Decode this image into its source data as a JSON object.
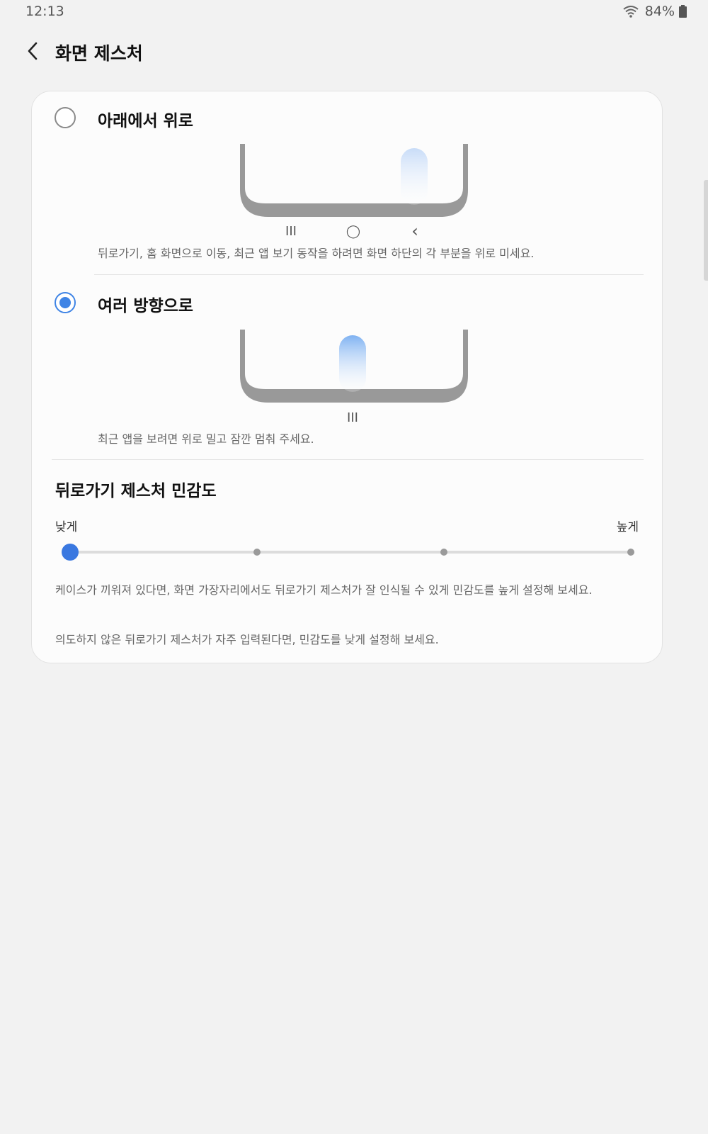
{
  "status": {
    "time": "12:13",
    "battery": "84%"
  },
  "header": {
    "title": "화면 제스처"
  },
  "options": [
    {
      "title": "아래에서 위로",
      "selected": false,
      "description": "뒤로가기, 홈 화면으로 이동, 최근 앱 보기 동작을 하려면 화면 하단의 각 부분을 위로 미세요.",
      "nav_keys": [
        "III",
        "◯",
        "‹"
      ]
    },
    {
      "title": "여러 방향으로",
      "selected": true,
      "description": "최근 앱을 보려면 위로 밀고 잠깐 멈춰 주세요.",
      "nav_keys": [
        "III"
      ]
    }
  ],
  "sensitivity": {
    "title": "뒤로가기 제스처 민감도",
    "low_label": "낮게",
    "high_label": "높게",
    "steps": 4,
    "value_index": 0,
    "help_1": "케이스가 끼워져 있다면, 화면 가장자리에서도 뒤로가기 제스처가 잘 인식될 수 있게 민감도를 높게 설정해 보세요.",
    "help_2": "의도하지 않은 뒤로가기 제스처가 자주 입력된다면, 민감도를 낮게 설정해 보세요."
  },
  "colors": {
    "accent": "#3f84e5",
    "slider_thumb": "#3a78e0",
    "phone_frame": "#999999"
  }
}
